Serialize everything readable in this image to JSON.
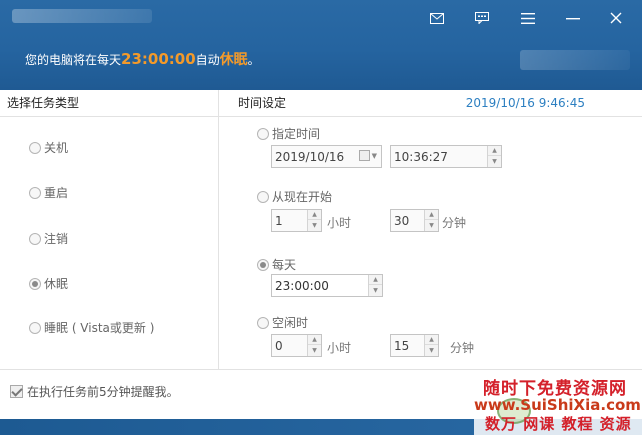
{
  "header": {
    "message_prefix": "您的电脑将在每天",
    "time": "23:00:00",
    "message_mid": "自动",
    "action": "休眠",
    "message_suffix": "。",
    "bg_color": "#2564a0",
    "accent_color": "#f39a2a",
    "window_buttons": [
      "mail-icon",
      "chat-icon",
      "menu-icon",
      "minimize-icon",
      "close-icon"
    ]
  },
  "left": {
    "heading": "选择任务类型",
    "options": [
      {
        "label": "关机",
        "checked": false
      },
      {
        "label": "重启",
        "checked": false
      },
      {
        "label": "注销",
        "checked": false
      },
      {
        "label": "休眠",
        "checked": true
      },
      {
        "label": "睡眠 ( Vista或更新 )",
        "checked": false
      }
    ]
  },
  "right": {
    "heading": "时间设定",
    "clock": "2019/10/16 9:46:45",
    "clock_color": "#2c7fc1",
    "specified": {
      "label": "指定时间",
      "checked": false,
      "date": "2019/10/16",
      "time": "10:36:27"
    },
    "from_now": {
      "label": "从现在开始",
      "checked": false,
      "hours": "1",
      "hours_unit": "小时",
      "minutes": "30",
      "minutes_unit": "分钟"
    },
    "daily": {
      "label": "每天",
      "checked": true,
      "time": "23:00:00"
    },
    "idle": {
      "label": "空闲时",
      "checked": false,
      "hours": "0",
      "hours_unit": "小时",
      "minutes": "15",
      "minutes_unit": "分钟"
    }
  },
  "footer": {
    "remind_label": "在执行任务前5分钟提醒我。",
    "remind_checked": true
  },
  "watermark": {
    "line1": "随时下免费资源网",
    "line2": "www.SuiShiXia.com",
    "line3": "数万 网课 教程 资源"
  }
}
